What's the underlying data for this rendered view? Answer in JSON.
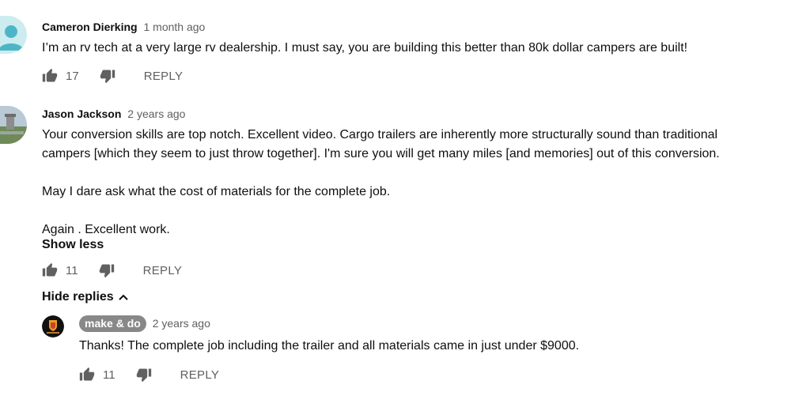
{
  "comments": [
    {
      "author": "Cameron Dierking",
      "time": "1 month ago",
      "text_lines": [
        "I’m an rv tech at a very large rv dealership. I must say, you are building this better than 80k dollar campers are built!"
      ],
      "likes": "17",
      "reply_label": "REPLY"
    },
    {
      "author": "Jason Jackson",
      "time": "2 years ago",
      "text_lines": [
        "Your conversion skills are top notch. Excellent video. Cargo trailers are inherently more structurally sound than traditional",
        "campers [which they seem to just throw together]. I'm sure you will get many miles [and memories] out of this conversion.",
        "",
        "May I dare ask what the cost of materials for the complete job.",
        "",
        "Again . Excellent work."
      ],
      "show_less": "Show less",
      "likes": "11",
      "reply_label": "REPLY",
      "hide_replies": "Hide replies"
    }
  ],
  "replies": [
    {
      "author": "make & do",
      "time": "2 years ago",
      "text": "Thanks! The complete job including the trailer and all materials came in just under $9000.",
      "likes": "11",
      "reply_label": "REPLY"
    }
  ],
  "colors": {
    "text": "#0f0f0f",
    "secondary": "#606060",
    "badge": "#888888",
    "avatar_teal": "#4db6c6"
  },
  "icons": [
    "like-icon",
    "dislike-icon",
    "chevron-up-icon"
  ]
}
